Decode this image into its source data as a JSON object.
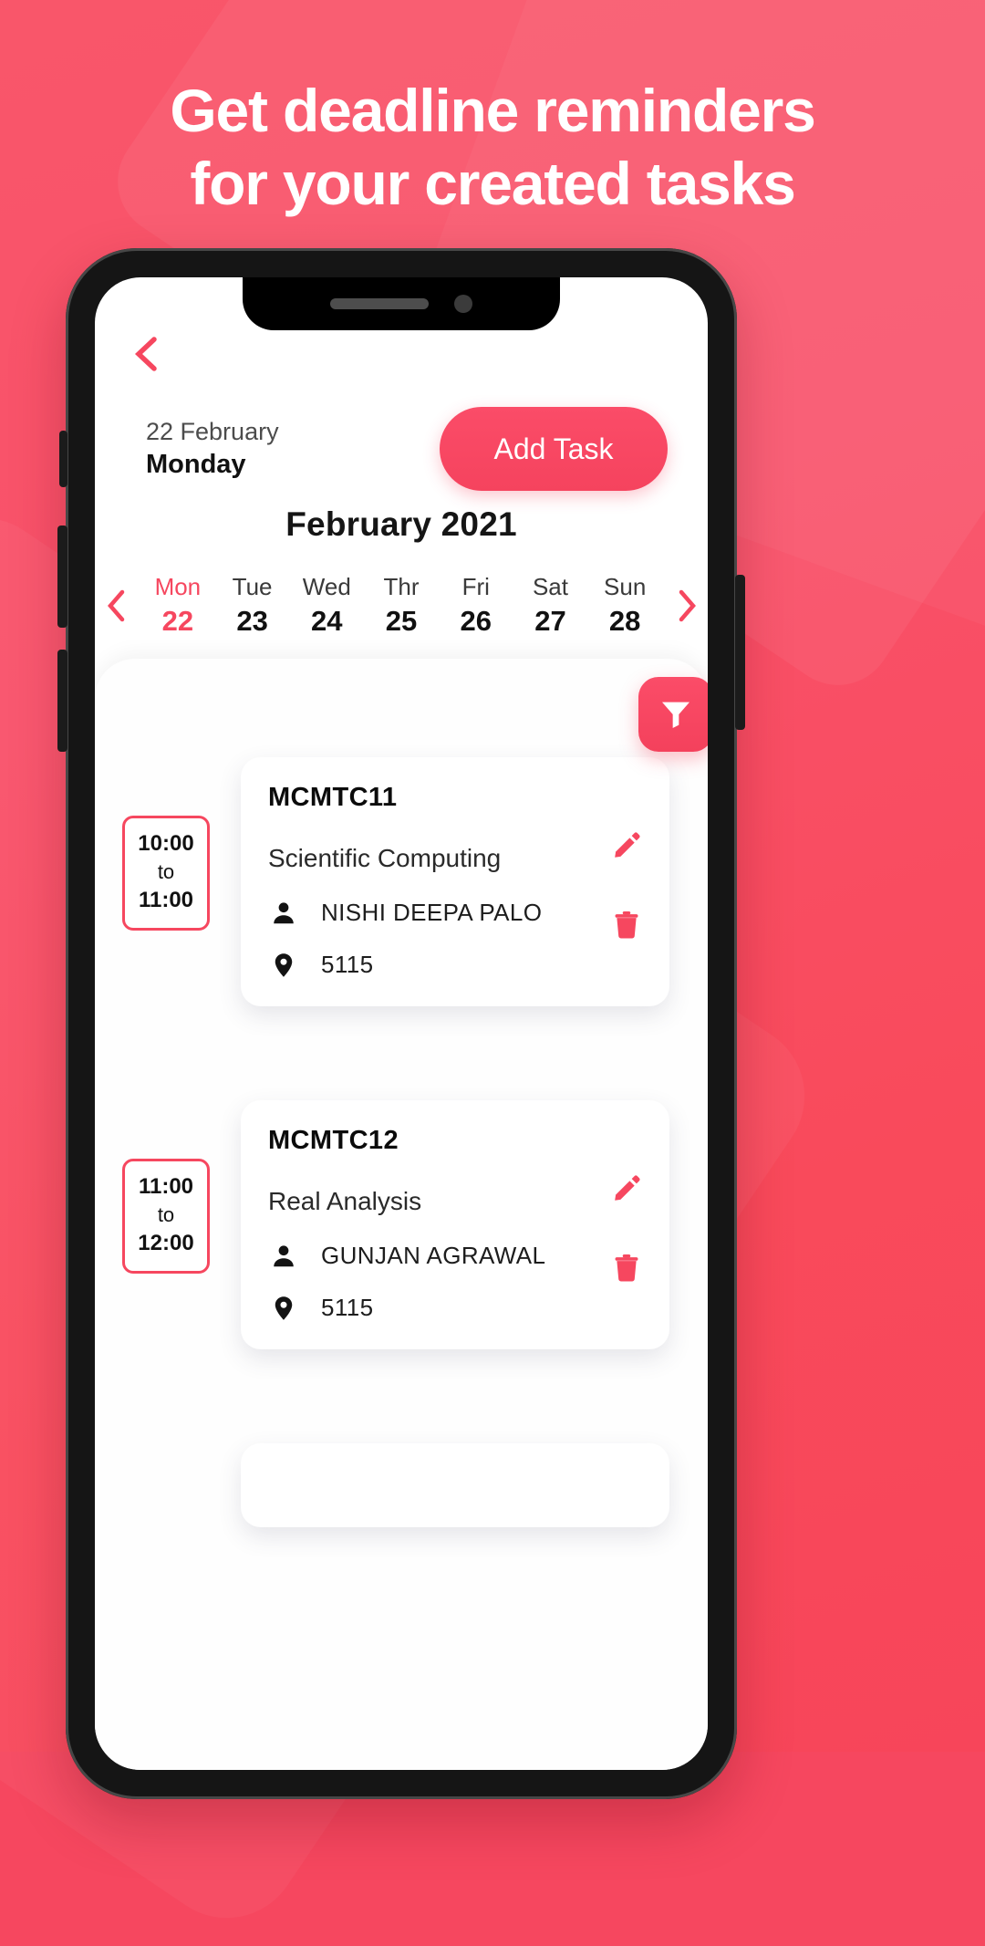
{
  "promo": {
    "headline_line1": "Get deadline reminders",
    "headline_line2": "for your created tasks",
    "background_color": "#F6475F",
    "accent_color": "#F6475F"
  },
  "app": {
    "back_icon": "chevron-left-icon",
    "header": {
      "date_day_month": "22 February",
      "weekday": "Monday",
      "add_task_label": "Add Task"
    },
    "month_title": "February 2021",
    "week_strip": {
      "prev_icon": "chevron-left-icon",
      "next_icon": "chevron-right-icon",
      "days": [
        {
          "dow": "Mon",
          "num": "22",
          "active": true
        },
        {
          "dow": "Tue",
          "num": "23",
          "active": false
        },
        {
          "dow": "Wed",
          "num": "24",
          "active": false
        },
        {
          "dow": "Thr",
          "num": "25",
          "active": false
        },
        {
          "dow": "Fri",
          "num": "26",
          "active": false
        },
        {
          "dow": "Sat",
          "num": "27",
          "active": false
        },
        {
          "dow": "Sun",
          "num": "28",
          "active": false
        }
      ]
    },
    "filter_button": {
      "icon": "filter-icon"
    },
    "time_separator": "to",
    "tasks": [
      {
        "start": "10:00",
        "end": "11:00",
        "code": "MCMTC11",
        "subject": "Scientific Computing",
        "person": "NISHI DEEPA PALO",
        "room": "5115",
        "person_icon": "person-icon",
        "location_icon": "location-pin-icon",
        "edit_icon": "pencil-icon",
        "delete_icon": "trash-icon"
      },
      {
        "start": "11:00",
        "end": "12:00",
        "code": "MCMTC12",
        "subject": "Real Analysis",
        "person": "GUNJAN AGRAWAL",
        "room": "5115",
        "person_icon": "person-icon",
        "location_icon": "location-pin-icon",
        "edit_icon": "pencil-icon",
        "delete_icon": "trash-icon"
      },
      {
        "start": "",
        "end": "",
        "code": "",
        "subject": "",
        "person": "",
        "room": "",
        "person_icon": "person-icon",
        "location_icon": "location-pin-icon",
        "edit_icon": "pencil-icon",
        "delete_icon": "trash-icon"
      }
    ]
  }
}
